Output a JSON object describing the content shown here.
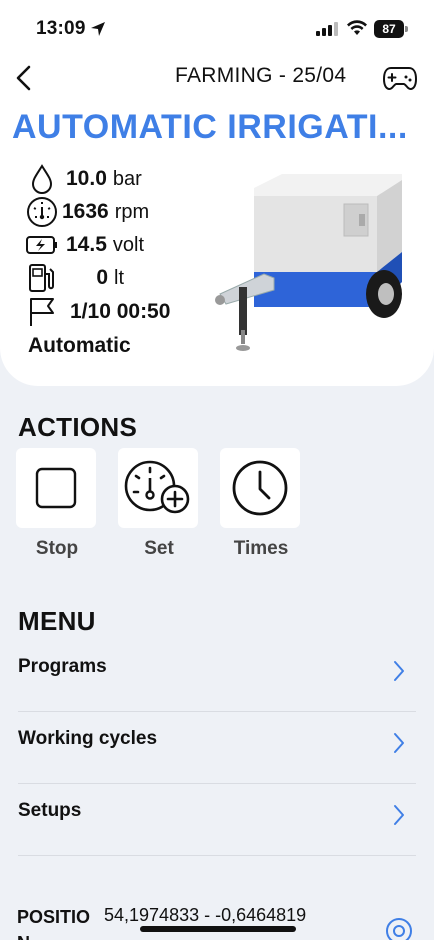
{
  "status_bar": {
    "time": "13:09",
    "battery": "87"
  },
  "header": {
    "title": "FARMING - 25/04",
    "back_icon": "chevron-left-icon",
    "gamepad_icon": "gamepad-icon"
  },
  "machine": {
    "name": "AUTOMATIC IRRIGATI...",
    "stats": [
      {
        "icon": "drop-icon",
        "value": "10.0",
        "unit": "bar"
      },
      {
        "icon": "gauge-icon",
        "value": "1636",
        "unit": "rpm"
      },
      {
        "icon": "battery-charge-icon",
        "value": "14.5",
        "unit": "volt"
      },
      {
        "icon": "fuel-pump-icon",
        "value": "0",
        "unit": "lt"
      },
      {
        "icon": "flag-icon",
        "value": "1/10 00:50",
        "unit": ""
      }
    ],
    "mode": "Automatic",
    "accent_color": "#3f7fe6"
  },
  "actions": {
    "title": "ACTIONS",
    "items": [
      {
        "label": "Stop",
        "icon": "stop-square-icon"
      },
      {
        "label": "Set",
        "icon": "gauge-plus-icon"
      },
      {
        "label": "Times",
        "icon": "clock-icon"
      }
    ]
  },
  "menu": {
    "title": "MENU",
    "items": [
      {
        "label": "Programs"
      },
      {
        "label": "Working cycles"
      },
      {
        "label": "Setups"
      }
    ]
  },
  "position": {
    "label": "POSITIO N",
    "coordinates": "54,1974833 - -0,6464819"
  }
}
